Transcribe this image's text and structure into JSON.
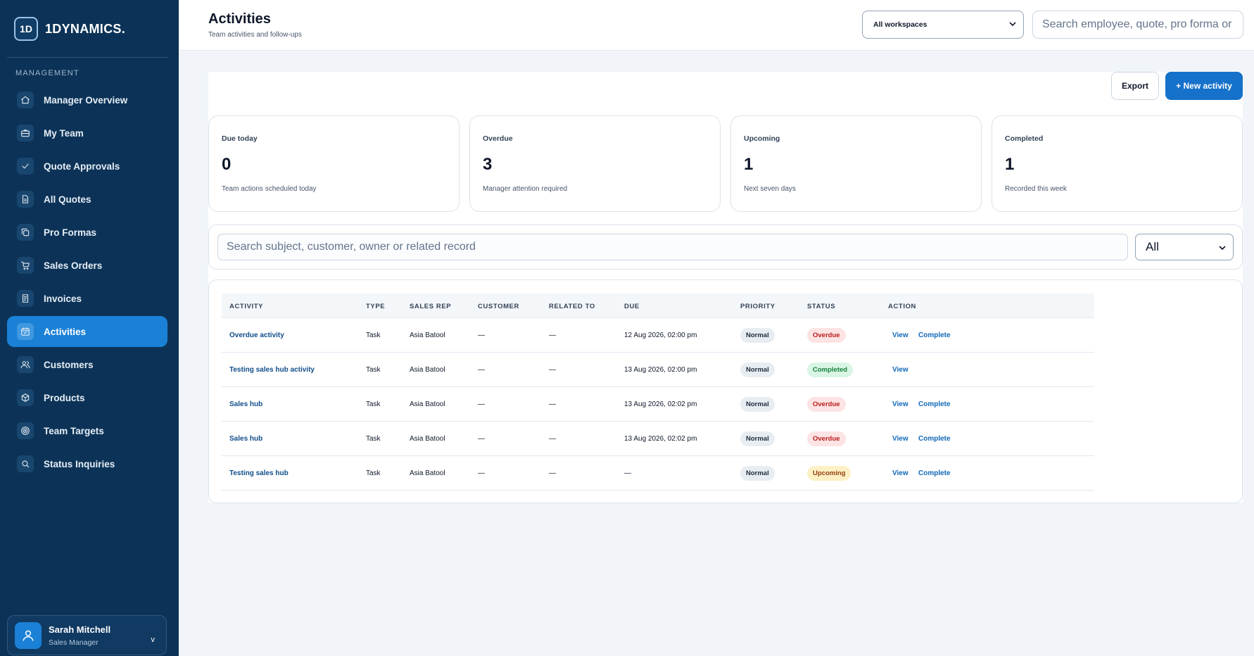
{
  "brand": {
    "mark": "1D",
    "name": "1DYNAMICS."
  },
  "sidebar": {
    "section_label": "MANAGEMENT",
    "items": [
      {
        "label": "Manager Overview",
        "icon": "home-icon"
      },
      {
        "label": "My Team",
        "icon": "briefcase-icon"
      },
      {
        "label": "Quote Approvals",
        "icon": "check-icon"
      },
      {
        "label": "All Quotes",
        "icon": "document-icon"
      },
      {
        "label": "Pro Formas",
        "icon": "copy-icon"
      },
      {
        "label": "Sales Orders",
        "icon": "cart-icon"
      },
      {
        "label": "Invoices",
        "icon": "receipt-icon"
      },
      {
        "label": "Activities",
        "icon": "calendar-icon",
        "active": true
      },
      {
        "label": "Customers",
        "icon": "users-icon"
      },
      {
        "label": "Products",
        "icon": "box-icon"
      },
      {
        "label": "Team Targets",
        "icon": "target-icon"
      },
      {
        "label": "Status Inquiries",
        "icon": "search-icon"
      }
    ],
    "user": {
      "name": "Sarah Mitchell",
      "role": "Sales Manager",
      "chevron": "v"
    }
  },
  "header": {
    "title": "Activities",
    "subtitle": "Team activities and follow-ups",
    "workspace_select": "All workspaces",
    "search_placeholder": "Search employee, quote, pro forma or"
  },
  "toolbar": {
    "export_label": "Export",
    "new_label": "+ New activity"
  },
  "stats": [
    {
      "label": "Due today",
      "value": "0",
      "note": "Team actions scheduled today"
    },
    {
      "label": "Overdue",
      "value": "3",
      "note": "Manager attention required"
    },
    {
      "label": "Upcoming",
      "value": "1",
      "note": "Next seven days"
    },
    {
      "label": "Completed",
      "value": "1",
      "note": "Recorded this week"
    }
  ],
  "filters": {
    "search_placeholder": "Search subject, customer, owner or related record",
    "status_select": "All"
  },
  "table": {
    "columns": [
      "ACTIVITY",
      "TYPE",
      "SALES REP",
      "CUSTOMER",
      "RELATED TO",
      "DUE",
      "PRIORITY",
      "STATUS",
      "ACTION"
    ],
    "rows": [
      {
        "activity": "Overdue activity",
        "type": "Task",
        "rep": "Asia Batool",
        "customer": "—",
        "related": "—",
        "due": "12 Aug 2026, 02:00 pm",
        "priority": "Normal",
        "status": "Overdue",
        "status_kind": "overdue",
        "actions": [
          "View",
          "Complete"
        ]
      },
      {
        "activity": "Testing sales hub activity",
        "type": "Task",
        "rep": "Asia Batool",
        "customer": "—",
        "related": "—",
        "due": "13 Aug 2026, 02:00 pm",
        "priority": "Normal",
        "status": "Completed",
        "status_kind": "completed",
        "actions": [
          "View"
        ]
      },
      {
        "activity": "Sales hub",
        "type": "Task",
        "rep": "Asia Batool",
        "customer": "—",
        "related": "—",
        "due": "13 Aug 2026, 02:02 pm",
        "priority": "Normal",
        "status": "Overdue",
        "status_kind": "overdue",
        "actions": [
          "View",
          "Complete"
        ]
      },
      {
        "activity": "Sales hub",
        "type": "Task",
        "rep": "Asia Batool",
        "customer": "—",
        "related": "—",
        "due": "13 Aug 2026, 02:02 pm",
        "priority": "Normal",
        "status": "Overdue",
        "status_kind": "overdue",
        "actions": [
          "View",
          "Complete"
        ]
      },
      {
        "activity": "Testing sales hub",
        "type": "Task",
        "rep": "Asia Batool",
        "customer": "—",
        "related": "—",
        "due": "—",
        "priority": "Normal",
        "status": "Upcoming",
        "status_kind": "upcoming",
        "actions": [
          "View",
          "Complete"
        ]
      }
    ]
  }
}
